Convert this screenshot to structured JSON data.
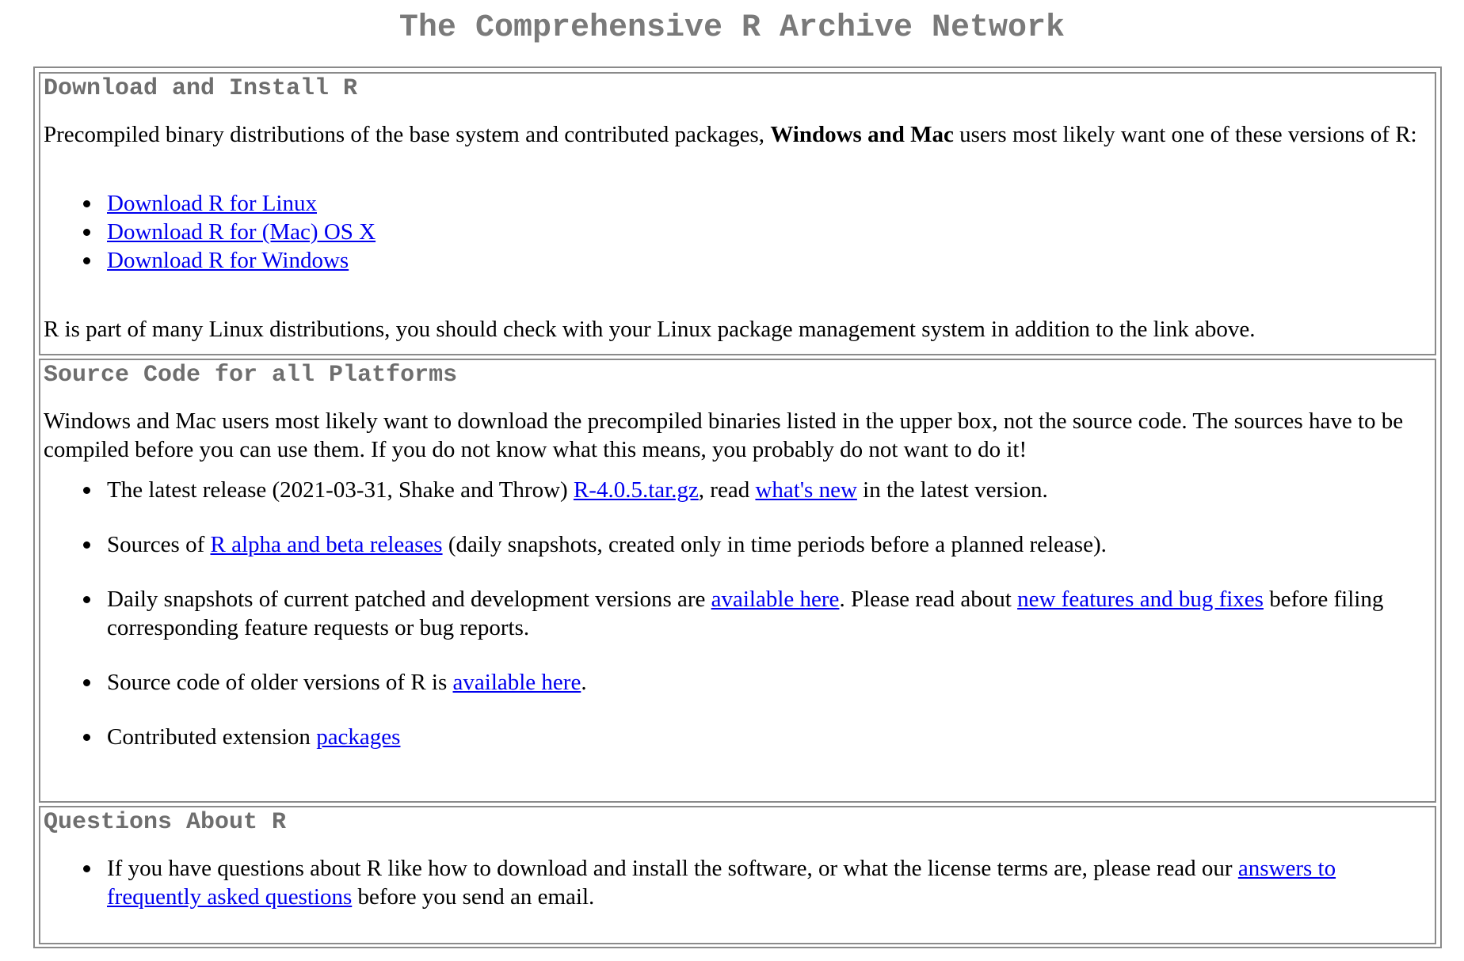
{
  "page_title": "The Comprehensive R Archive Network",
  "sections": {
    "download": {
      "heading": "Download and Install R",
      "intro_before": "Precompiled binary distributions of the base system and contributed packages, ",
      "intro_bold": "Windows and Mac",
      "intro_after": " users most likely want one of these versions of R:",
      "links": [
        "Download R for Linux",
        "Download R for (Mac) OS X",
        "Download R for Windows"
      ],
      "footer": "R is part of many Linux distributions, you should check with your Linux package management system in addition to the link above."
    },
    "source": {
      "heading": "Source Code for all Platforms",
      "intro": "Windows and Mac users most likely want to download the precompiled binaries listed in the upper box, not the source code. The sources have to be compiled before you can use them. If you do not know what this means, you probably do not want to do it!",
      "items": {
        "latest_before": "The latest release (2021-03-31, Shake and Throw) ",
        "latest_link": "R-4.0.5.tar.gz",
        "latest_mid": ", read ",
        "latest_link2": "what's new",
        "latest_after": " in the latest version.",
        "alpha_before": "Sources of ",
        "alpha_link": "R alpha and beta releases",
        "alpha_after": " (daily snapshots, created only in time periods before a planned release).",
        "daily_before": "Daily snapshots of current patched and development versions are ",
        "daily_link": "available here",
        "daily_mid": ". Please read about ",
        "daily_link2": "new features and bug fixes",
        "daily_after": " before filing corresponding feature requests or bug reports.",
        "older_before": "Source code of older versions of R is ",
        "older_link": "available here",
        "older_after": ".",
        "contrib_before": "Contributed extension ",
        "contrib_link": "packages"
      }
    },
    "questions": {
      "heading": "Questions About R",
      "item_before": "If you have questions about R like how to download and install the software, or what the license terms are, please read our ",
      "item_link": "answers to frequently asked questions",
      "item_after": " before you send an email."
    }
  }
}
